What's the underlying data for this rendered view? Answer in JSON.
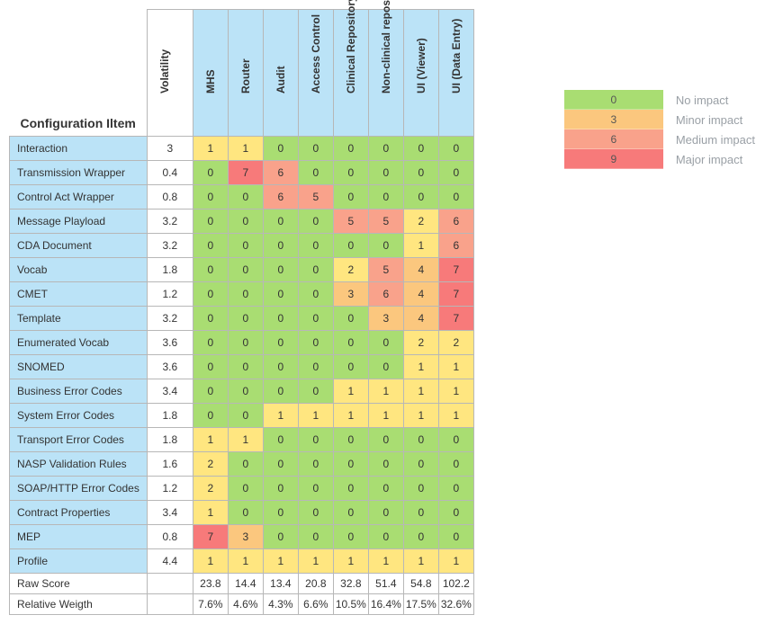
{
  "chart_data": {
    "type": "heatmap",
    "title": "Configuration Iltem",
    "row_header": "Configuration Iltem",
    "volatility_label": "Volatility",
    "columns": [
      "MHS",
      "Router",
      "Audit",
      "Access Control",
      "Clinical Repository",
      "Non-clinical repository",
      "UI (Viewer)",
      "UI (Data Entry)"
    ],
    "rows": [
      {
        "label": "Interaction",
        "volatility": "3",
        "v": [
          1,
          1,
          0,
          0,
          0,
          0,
          0,
          0
        ]
      },
      {
        "label": "Transmission Wrapper",
        "volatility": "0.4",
        "v": [
          0,
          7,
          6,
          0,
          0,
          0,
          0,
          0
        ]
      },
      {
        "label": "Control Act Wrapper",
        "volatility": "0.8",
        "v": [
          0,
          0,
          6,
          5,
          0,
          0,
          0,
          0
        ]
      },
      {
        "label": "Message Playload",
        "volatility": "3.2",
        "v": [
          0,
          0,
          0,
          0,
          5,
          5,
          2,
          6
        ]
      },
      {
        "label": "CDA Document",
        "volatility": "3.2",
        "v": [
          0,
          0,
          0,
          0,
          0,
          0,
          1,
          6
        ]
      },
      {
        "label": "Vocab",
        "volatility": "1.8",
        "v": [
          0,
          0,
          0,
          0,
          2,
          5,
          4,
          7
        ]
      },
      {
        "label": "CMET",
        "volatility": "1.2",
        "v": [
          0,
          0,
          0,
          0,
          3,
          6,
          4,
          7
        ]
      },
      {
        "label": "Template",
        "volatility": "3.2",
        "v": [
          0,
          0,
          0,
          0,
          0,
          3,
          4,
          7
        ]
      },
      {
        "label": "Enumerated Vocab",
        "volatility": "3.6",
        "v": [
          0,
          0,
          0,
          0,
          0,
          0,
          2,
          2
        ]
      },
      {
        "label": "SNOMED",
        "volatility": "3.6",
        "v": [
          0,
          0,
          0,
          0,
          0,
          0,
          1,
          1
        ]
      },
      {
        "label": "Business Error Codes",
        "volatility": "3.4",
        "v": [
          0,
          0,
          0,
          0,
          1,
          1,
          1,
          1
        ]
      },
      {
        "label": "System Error Codes",
        "volatility": "1.8",
        "v": [
          0,
          0,
          1,
          1,
          1,
          1,
          1,
          1
        ]
      },
      {
        "label": "Transport Error Codes",
        "volatility": "1.8",
        "v": [
          1,
          1,
          0,
          0,
          0,
          0,
          0,
          0
        ]
      },
      {
        "label": "NASP Validation Rules",
        "volatility": "1.6",
        "v": [
          2,
          0,
          0,
          0,
          0,
          0,
          0,
          0
        ]
      },
      {
        "label": "SOAP/HTTP Error Codes",
        "volatility": "1.2",
        "v": [
          2,
          0,
          0,
          0,
          0,
          0,
          0,
          0
        ]
      },
      {
        "label": "Contract Properties",
        "volatility": "3.4",
        "v": [
          1,
          0,
          0,
          0,
          0,
          0,
          0,
          0
        ]
      },
      {
        "label": "MEP",
        "volatility": "0.8",
        "v": [
          7,
          3,
          0,
          0,
          0,
          0,
          0,
          0
        ]
      },
      {
        "label": "Profile",
        "volatility": "4.4",
        "v": [
          1,
          1,
          1,
          1,
          1,
          1,
          1,
          1
        ]
      }
    ],
    "summary": [
      {
        "label": "Raw Score",
        "v": [
          "23.8",
          "14.4",
          "13.4",
          "20.8",
          "32.8",
          "51.4",
          "54.8",
          "102.2"
        ]
      },
      {
        "label": "Relative Weigth",
        "v": [
          "7.6%",
          "4.6%",
          "4.3%",
          "6.6%",
          "10.5%",
          "16.4%",
          "17.5%",
          "32.6%"
        ]
      }
    ],
    "legend": [
      {
        "value": "0",
        "label": "No impact",
        "class": "lg0"
      },
      {
        "value": "3",
        "label": "Minor impact",
        "class": "lg3"
      },
      {
        "value": "6",
        "label": "Medium impact",
        "class": "lg6"
      },
      {
        "value": "9",
        "label": "Major impact",
        "class": "lg9"
      }
    ]
  }
}
